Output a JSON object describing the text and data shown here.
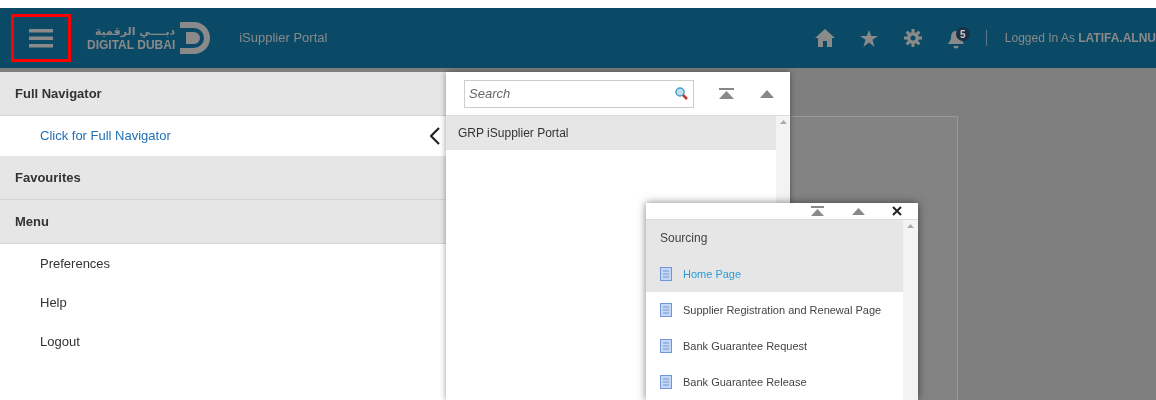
{
  "header": {
    "logo_arabic": "دبــــي الرقمية",
    "logo_text": "DIGITAL DUBAI",
    "app_title": "iSupplier Portal",
    "notification_count": "5",
    "login_label": "Logged In As",
    "login_user": "LATIFA.ALNU"
  },
  "navigator": {
    "sections": [
      {
        "kind": "header",
        "label": "Full Navigator"
      },
      {
        "kind": "link",
        "label": "Click for Full Navigator"
      },
      {
        "kind": "header",
        "label": "Favourites"
      },
      {
        "kind": "header",
        "label": "Menu"
      },
      {
        "kind": "item",
        "label": "Preferences"
      },
      {
        "kind": "item",
        "label": "Help"
      },
      {
        "kind": "item",
        "label": "Logout"
      }
    ]
  },
  "search_panel": {
    "search": {
      "placeholder": "Search"
    },
    "items": [
      {
        "label": "GRP iSupplier Portal",
        "selected": true
      }
    ]
  },
  "submenu": {
    "heading": "Sourcing",
    "items": [
      {
        "label": "Home Page",
        "selected": true
      },
      {
        "label": "Supplier Registration and Renewal Page",
        "selected": false
      },
      {
        "label": "Bank Guarantee Request",
        "selected": false
      },
      {
        "label": "Bank Guarantee Release",
        "selected": false
      }
    ]
  }
}
